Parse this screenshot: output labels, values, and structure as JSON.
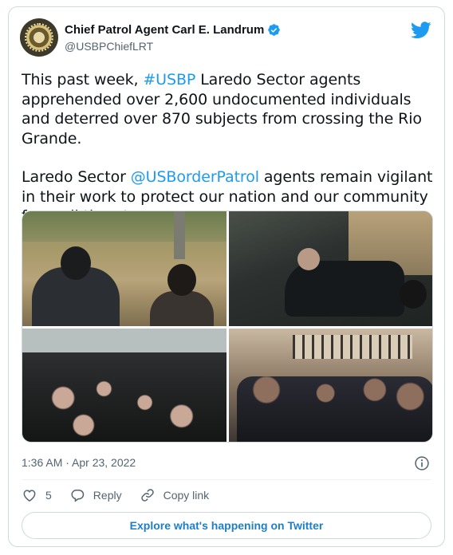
{
  "author": {
    "name": "Chief Patrol Agent Carl E. Landrum",
    "handle": "@USBPChiefLRT",
    "verified": true,
    "avatar_icon": "usbp-seal-icon"
  },
  "tweet": {
    "p1_pre": "This past week, ",
    "p1_link": "#USBP",
    "p1_post": " Laredo Sector agents apprehended over 2,600 undocumented individuals and deterred over 870 subjects from crossing the Rio Grande.",
    "p2_pre": "Laredo Sector ",
    "p2_link": "@USBorderPatrol",
    "p2_post": " agents remain vigilant in their work to protect our nation and our community from all threats."
  },
  "media": {
    "photos": [
      {
        "description_icon": "photo-icon"
      },
      {
        "description_icon": "photo-icon"
      },
      {
        "description_icon": "photo-icon"
      },
      {
        "description_icon": "photo-icon"
      }
    ]
  },
  "meta": {
    "timestamp": "1:36 AM · Apr 23, 2022"
  },
  "actions": {
    "like_count": "5",
    "reply_label": "Reply",
    "copy_link_label": "Copy link"
  },
  "footer": {
    "explore_label": "Explore what's happening on Twitter"
  },
  "colors": {
    "link": "#1d9bf0",
    "text": "#0f1419",
    "muted": "#536471",
    "border": "#cfd9de"
  }
}
